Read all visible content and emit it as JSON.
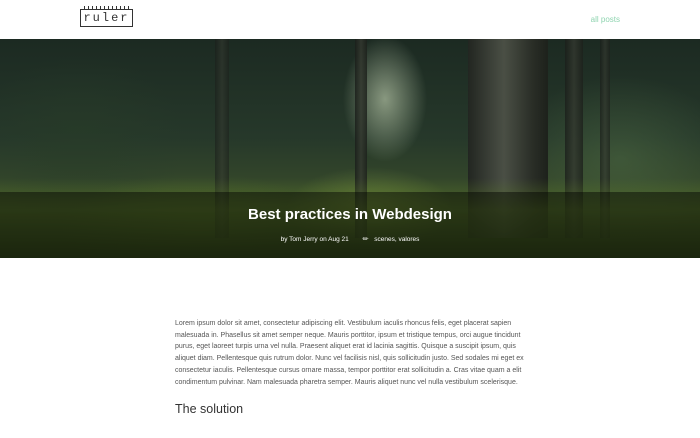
{
  "header": {
    "logo_text": "ruler",
    "nav_link": "all posts"
  },
  "hero": {
    "title": "Best practices in Webdesign",
    "meta_byline": "by Tom Jerry on Aug 21",
    "meta_tags": "scenes, valores"
  },
  "article": {
    "paragraph": "Lorem ipsum dolor sit amet, consectetur adipiscing elit. Vestibulum iaculis rhoncus felis, eget placerat sapien malesuada in. Phasellus sit amet semper neque. Mauris porttitor, ipsum et tristique tempus, orci augue tincidunt purus, eget laoreet turpis urna vel nulla. Praesent aliquet erat id lacinia sagittis. Quisque a suscipit ipsum, quis aliquet diam. Pellentesque quis rutrum dolor. Nunc vel facilisis nisl, quis sollicitudin justo. Sed sodales mi eget ex consectetur iaculis. Pellentesque cursus ornare massa, tempor porttitor erat sollicitudin a. Cras vitae quam a elit condimentum pulvinar. Nam malesuada pharetra semper. Mauris aliquet nunc vel nulla vestibulum scelerisque.",
    "section_heading": "The solution"
  },
  "colors": {
    "accent": "#8fd4b0",
    "text": "#555555"
  }
}
